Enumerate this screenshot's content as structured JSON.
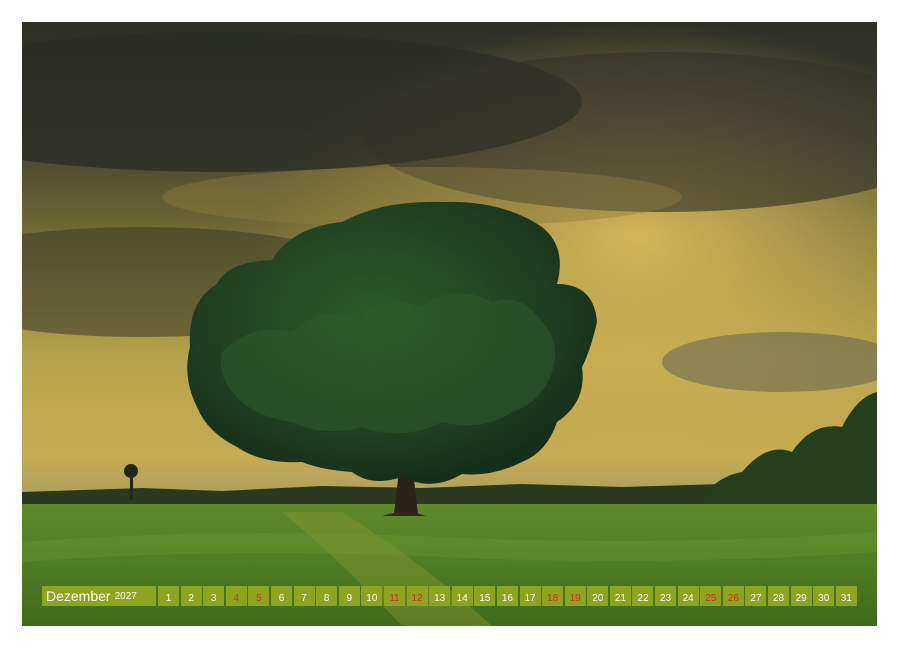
{
  "calendar": {
    "month": "Dezember",
    "year": "2027",
    "days": [
      {
        "n": "1",
        "we": false
      },
      {
        "n": "2",
        "we": false
      },
      {
        "n": "3",
        "we": false
      },
      {
        "n": "4",
        "we": true
      },
      {
        "n": "5",
        "we": true
      },
      {
        "n": "6",
        "we": false
      },
      {
        "n": "7",
        "we": false
      },
      {
        "n": "8",
        "we": false
      },
      {
        "n": "9",
        "we": false
      },
      {
        "n": "10",
        "we": false
      },
      {
        "n": "11",
        "we": true
      },
      {
        "n": "12",
        "we": true
      },
      {
        "n": "13",
        "we": false
      },
      {
        "n": "14",
        "we": false
      },
      {
        "n": "15",
        "we": false
      },
      {
        "n": "16",
        "we": false
      },
      {
        "n": "17",
        "we": false
      },
      {
        "n": "18",
        "we": true
      },
      {
        "n": "19",
        "we": true
      },
      {
        "n": "20",
        "we": false
      },
      {
        "n": "21",
        "we": false
      },
      {
        "n": "22",
        "we": false
      },
      {
        "n": "23",
        "we": false
      },
      {
        "n": "24",
        "we": false
      },
      {
        "n": "25",
        "we": true
      },
      {
        "n": "26",
        "we": true
      },
      {
        "n": "27",
        "we": false
      },
      {
        "n": "28",
        "we": false
      },
      {
        "n": "29",
        "we": false
      },
      {
        "n": "30",
        "we": false
      },
      {
        "n": "31",
        "we": false
      }
    ]
  },
  "colors": {
    "accent": "#8da51e",
    "weekend": "#d32d1b"
  }
}
